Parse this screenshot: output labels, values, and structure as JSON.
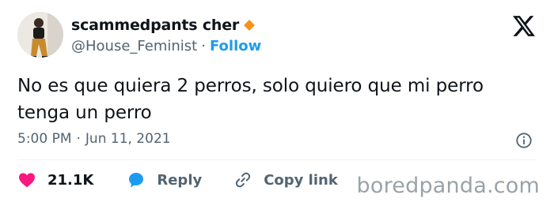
{
  "author": {
    "display_name": "scammedpants cher",
    "handle": "@House_Feminist",
    "separator": "·",
    "follow_label": "Follow",
    "verified_color": "#f7931a"
  },
  "tweet": {
    "text": "No es que quiera 2 perros, solo quiero que mi perro tenga un perro",
    "time": "5:00 PM",
    "date": "Jun 11, 2021"
  },
  "actions": {
    "likes_count": "21.1K",
    "reply_label": "Reply",
    "copy_link_label": "Copy link"
  },
  "watermark": "boredpanda.com",
  "colors": {
    "accent": "#1d9bf0",
    "like": "#f91880",
    "secondary_text": "#536471"
  },
  "icons": {
    "brand": "x-logo-icon",
    "like": "heart-icon",
    "reply": "speech-bubble-icon",
    "copy": "link-icon",
    "info": "info-icon"
  }
}
